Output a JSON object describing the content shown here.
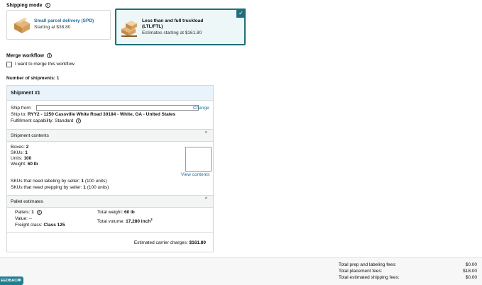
{
  "shipping_mode": {
    "label": "Shipping mode",
    "options": [
      {
        "title": "Small parcel delivery (SPD)",
        "price": "Starting at $38.80",
        "selected": false
      },
      {
        "title_line1": "Less than and full truckload",
        "title_line2": "(LTL/FTL)",
        "price": "Estimates starting at $161.80",
        "selected": true
      }
    ],
    "check_glyph": "✓"
  },
  "merge": {
    "label": "Merge workflow",
    "checkbox_label": "I want to merge this workflow"
  },
  "shipments_count": "Number of shipments: 1",
  "shipment": {
    "title": "Shipment #1",
    "ship_from_label": "Ship from:",
    "ship_from_value": "",
    "change_link": "Change",
    "ship_to_label": "Ship to:",
    "ship_to_value": "RYY2 - 1250 Cassville White Road 30184 - White, GA - United States",
    "fulfillment_label": "Fulfillment capability:",
    "fulfillment_value": "Standard",
    "contents": {
      "header": "Shipment contents",
      "boxes_label": "Boxes:",
      "boxes_value": "2",
      "skus_label": "SKUs:",
      "skus_value": "1",
      "units_label": "Units:",
      "units_value": "100",
      "weight_label": "Weight:",
      "weight_value": "60 lb",
      "view_contents": "View contents",
      "labeling_label": "SKUs that need labeling by seller:",
      "labeling_value": "1",
      "labeling_units": "(100 units)",
      "prepping_label": "SKUs that need prepping by seller:",
      "prepping_value": "1",
      "prepping_units": "(100 units)"
    },
    "pallet": {
      "header": "Pallet estimates",
      "pallets_label": "Pallets:",
      "pallets_value": "1",
      "value_label": "Value:",
      "value_value": "--",
      "freight_label": "Freight class:",
      "freight_value": "Class 125",
      "total_weight_label": "Total weight:",
      "total_weight_value": "60 lb",
      "total_volume_label": "Total volume:",
      "total_volume_value": "17,280 inch",
      "total_volume_sup": "3"
    },
    "carrier_label": "Estimated carrier charges:",
    "carrier_value": "$161.80"
  },
  "fees": [
    {
      "label": "Total prep and labeling fees:",
      "value": "$0.00"
    },
    {
      "label": "Total placement fees:",
      "value": "$18.00"
    },
    {
      "label": "Total estimated shipping fees:",
      "value": "$0.00"
    }
  ],
  "feedback": {
    "label": "EEDBACK",
    "close": "×"
  },
  "icons": {
    "info": "i",
    "chevron_up": "^"
  }
}
